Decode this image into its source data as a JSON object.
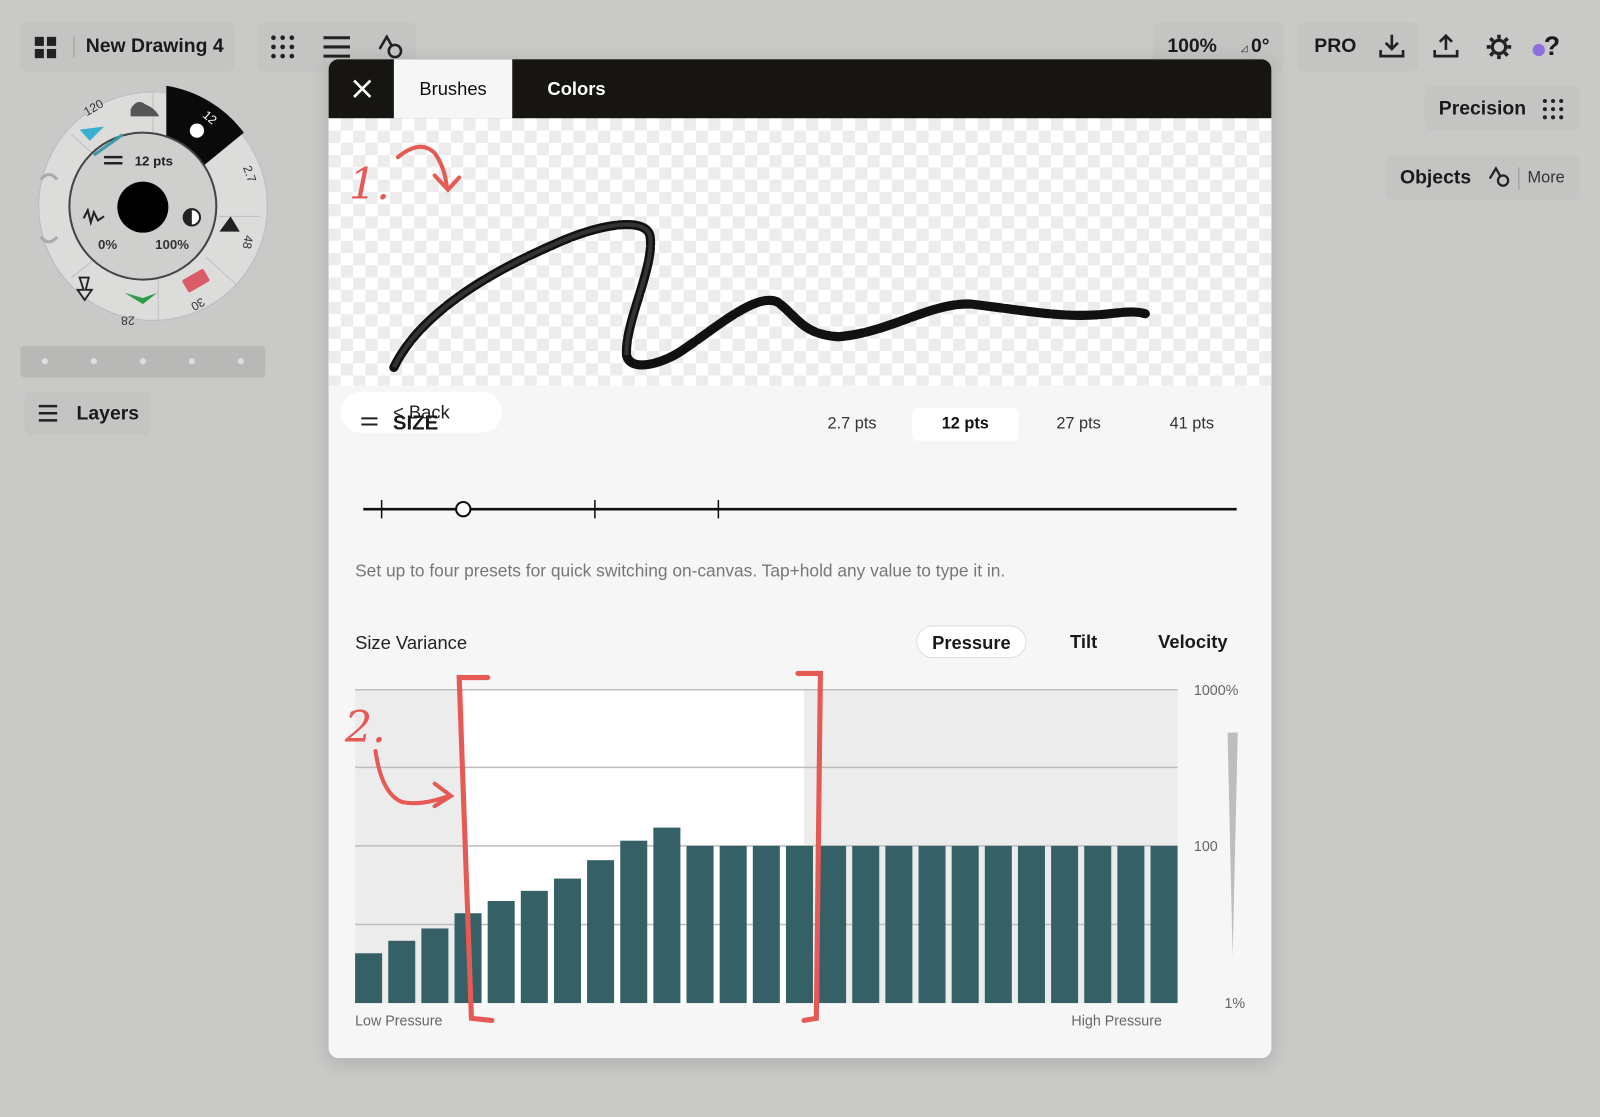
{
  "toolbar": {
    "gallery_label": "New Drawing 4",
    "zoom": "100%",
    "rotation": "0°",
    "pro_label": "PRO"
  },
  "right_panel": {
    "precision_label": "Precision",
    "objects_label": "Objects",
    "more_label": "More"
  },
  "tool_wheel": {
    "center_size": "12 pts",
    "smoothing": "0%",
    "opacity": "100%",
    "slots": [
      "120",
      "12",
      "2.7",
      "48",
      "30",
      "28"
    ]
  },
  "layers_label": "Layers",
  "dialog": {
    "tabs": [
      {
        "label": "Brushes",
        "active": true
      },
      {
        "label": "Colors",
        "active": false
      }
    ],
    "back_label": "< Back",
    "size": {
      "title": "SIZE",
      "presets": [
        "2.7 pts",
        "12 pts",
        "27 pts",
        "41 pts"
      ],
      "selected_preset": "12 pts",
      "slider_value_pts": 12,
      "hint": "Set up to four presets for quick switching on-canvas. Tap+hold any value to type it in."
    },
    "variance": {
      "title": "Size Variance",
      "modes": [
        "Pressure",
        "Tilt",
        "Velocity"
      ],
      "selected_mode": "Pressure"
    }
  },
  "annotations": {
    "one": "1.",
    "two": "2.",
    "color": "#e65a55"
  },
  "chart_data": {
    "type": "bar",
    "xlabel_left": "Low Pressure",
    "xlabel_right": "High Pressure",
    "y_ticks": [
      "1000%",
      "100",
      "1%"
    ],
    "scale": "log",
    "values": [
      4.3,
      6.2,
      8.9,
      13.9,
      19.9,
      26.8,
      38.4,
      65.8,
      108,
      131,
      100,
      100,
      100,
      100,
      100,
      100,
      100,
      100,
      100,
      100,
      100,
      100,
      100,
      100,
      100
    ],
    "bar_color": "#356066"
  }
}
